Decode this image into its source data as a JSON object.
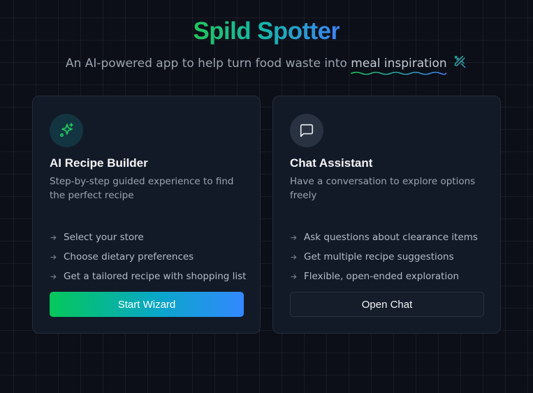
{
  "header": {
    "title": "Spild Spotter",
    "subtitle_prefix": "An AI-powered app to help turn food waste into",
    "subtitle_highlight": "meal inspiration",
    "subtitle_icon": "utensils-icon"
  },
  "colors": {
    "accent_green": "#22c55e",
    "accent_blue": "#3b82f6",
    "background": "#0c0f17",
    "card_background": "#131a27"
  },
  "cards": [
    {
      "icon": "sparkles-icon",
      "title": "AI Recipe Builder",
      "description": "Step-by-step guided experience to find the perfect recipe",
      "features": [
        "Select your store",
        "Choose dietary preferences",
        "Get a tailored recipe with shopping list"
      ],
      "button_label": "Start Wizard"
    },
    {
      "icon": "message-square-icon",
      "title": "Chat Assistant",
      "description": "Have a conversation to explore options freely",
      "features": [
        "Ask questions about clearance items",
        "Get multiple recipe suggestions",
        "Flexible, open-ended exploration"
      ],
      "button_label": "Open Chat"
    }
  ]
}
